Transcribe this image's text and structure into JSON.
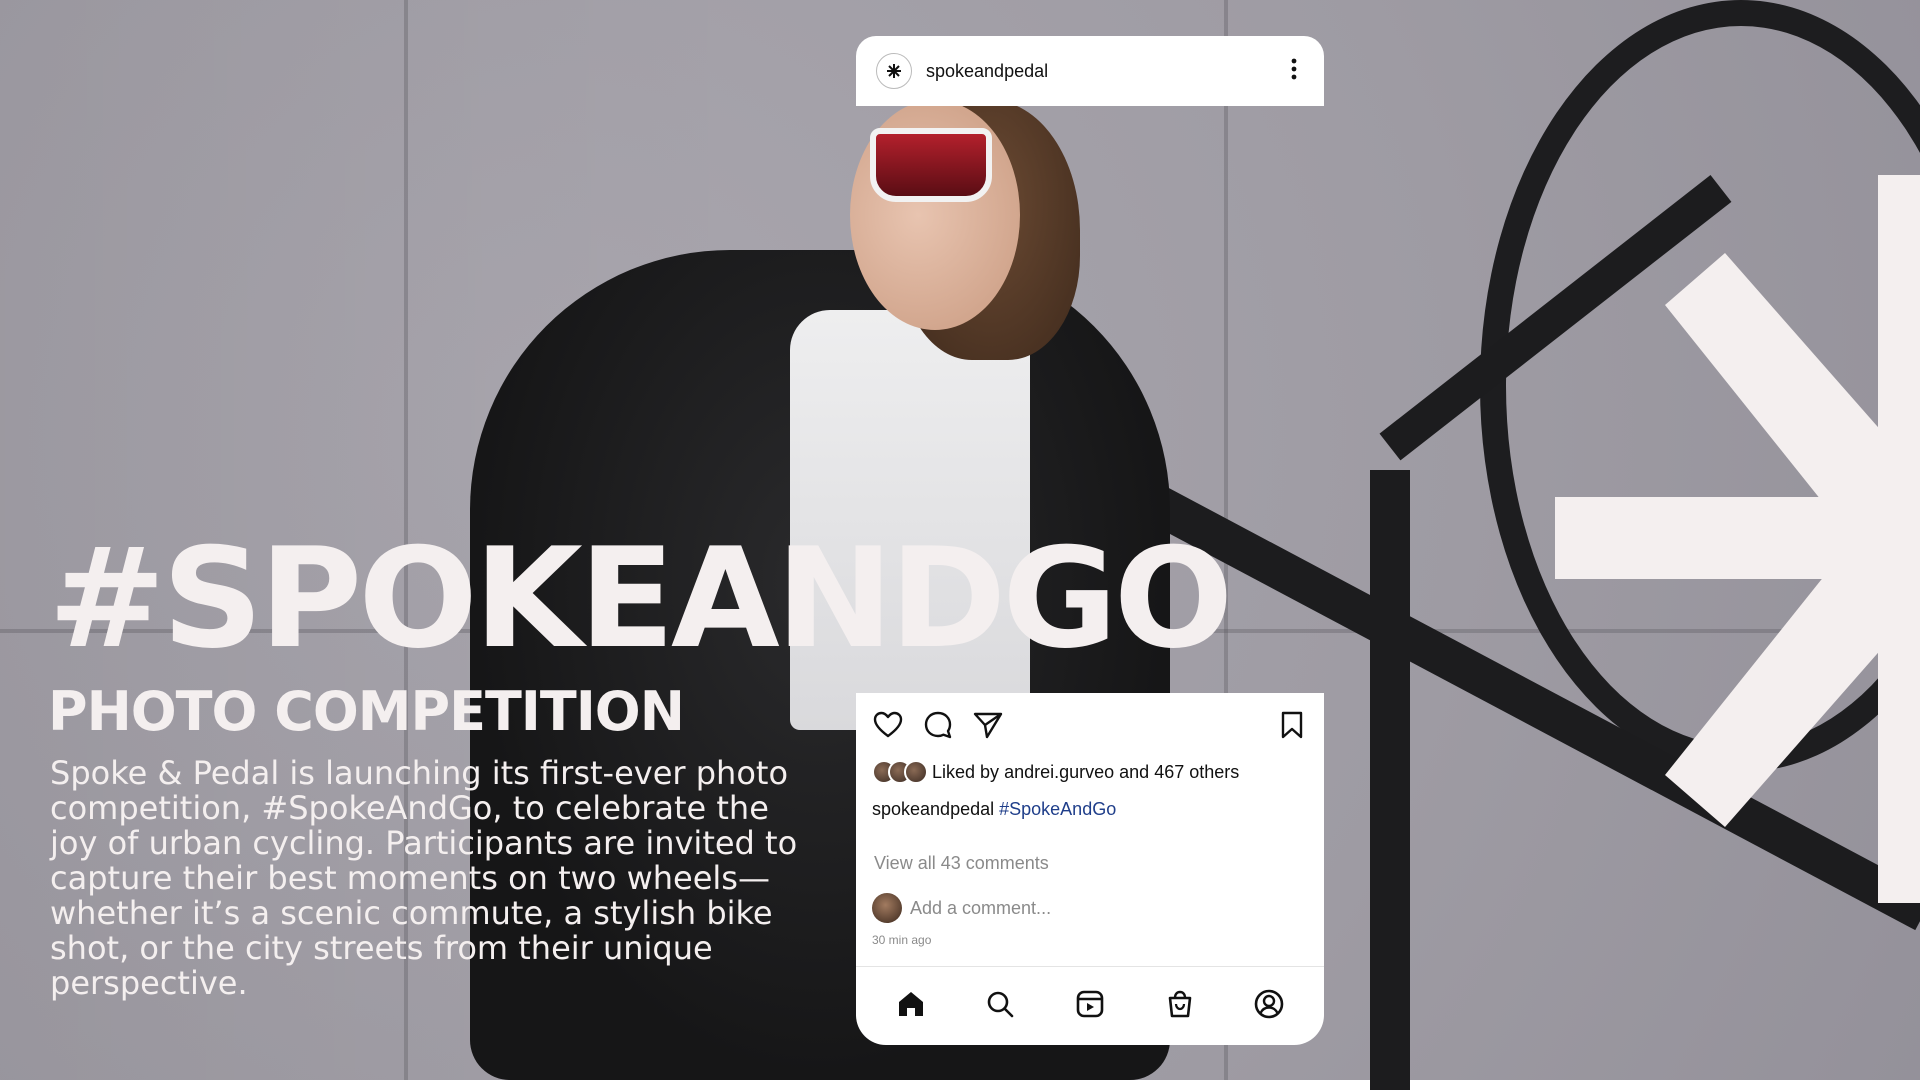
{
  "headline": "#SPOKEANDGO",
  "subhead": "PHOTO COMPETITION",
  "body": "Spoke & Pedal is launching its first-ever photo competition, #SpokeAndGo, to celebrate the joy of urban cycling. Participants are invited to capture their best moments on two wheels—whether it’s a scenic commute, a stylish bike shot, or the city streets from their unique perspective.",
  "post": {
    "username": "spokeandpedal",
    "more_icon": "more-vertical-icon",
    "liked_by_prefix": "Liked by",
    "liked_by_user": "andrei.gurveo",
    "liked_by_and": "and",
    "liked_by_others": "467 others",
    "caption_user": "spokeandpedal",
    "caption_hashtag": "#SpokeAndGo",
    "view_comments": "View all 43 comments",
    "add_comment_placeholder": "Add a comment...",
    "time_ago": "30 min ago",
    "actions": [
      "heart-icon",
      "comment-icon",
      "share-icon",
      "bookmark-icon"
    ],
    "nav": [
      "home-icon",
      "search-icon",
      "reels-icon",
      "shop-icon",
      "profile-icon"
    ]
  },
  "colors": {
    "text_light": "#f4efef",
    "hashtag": "#1f3e8a",
    "muted": "#8a8a8a"
  }
}
